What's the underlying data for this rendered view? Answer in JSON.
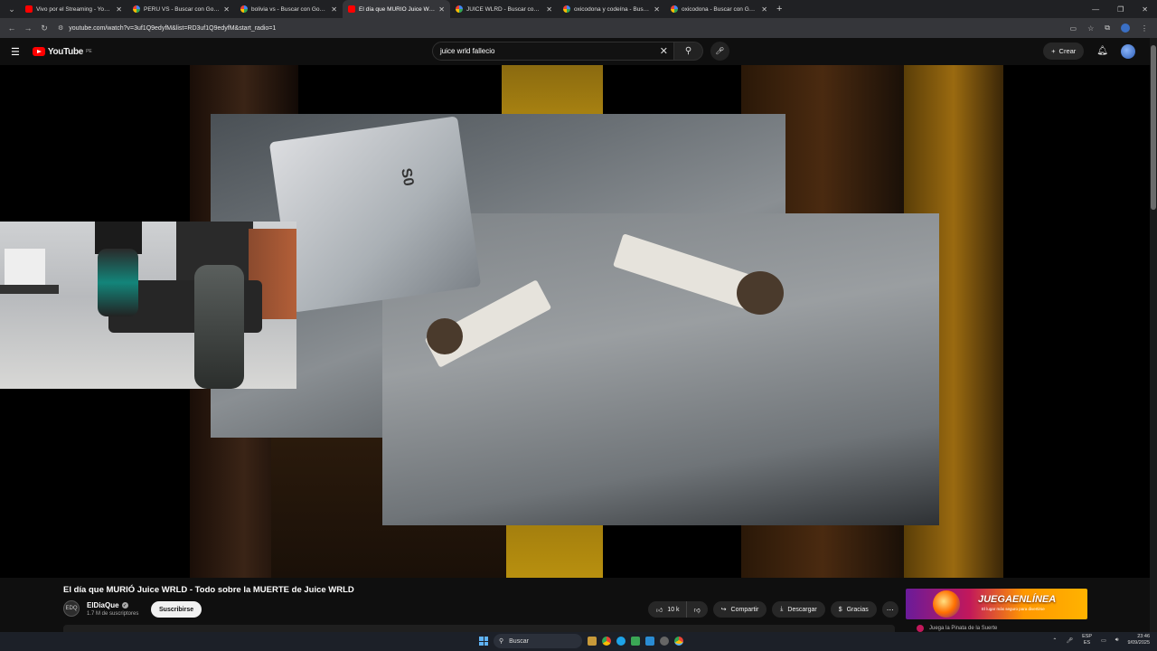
{
  "browser": {
    "tabs": [
      {
        "title": "Vivo por el Streaming - YouTube",
        "icon": "youtube-icon",
        "active": false
      },
      {
        "title": "PERU VS - Buscar con Google",
        "icon": "google-icon",
        "active": false
      },
      {
        "title": "bolivia vs - Buscar con Google",
        "icon": "google-icon",
        "active": false
      },
      {
        "title": "El día que MURIÓ Juice WRLD",
        "icon": "youtube-icon",
        "active": true
      },
      {
        "title": "JUICE WLRD - Buscar con Google",
        "icon": "google-icon",
        "active": false
      },
      {
        "title": "oxicodona y codeína - Buscar con Google",
        "icon": "google-icon",
        "active": false
      },
      {
        "title": "oxicodona - Buscar con Google",
        "icon": "google-icon",
        "active": false
      }
    ],
    "url": "youtube.com/watch?v=3uf1Q9edyfM&list=RD3uf1Q9edyfM&start_radio=1"
  },
  "youtube": {
    "logo_text": "YouTube",
    "country_code": "PE",
    "search_query": "juice wrld fallecio",
    "create_label": "Crear"
  },
  "video": {
    "title": "El día que MURIÓ Juice WRLD - Todo sobre la MUERTE de Juice WRLD",
    "channel_name": "ElDiaQue",
    "channel_avatar_text": "EDQ",
    "subscribers": "1.7 M de suscriptores",
    "subscribe_label": "Suscribirse",
    "likes": "10 k",
    "share_label": "Compartir",
    "download_label": "Descargar",
    "thanks_label": "Gracias",
    "overlay_text": "S0"
  },
  "ad": {
    "title": "JUEGAENLÍNEA",
    "subtitle": "El lugar más seguro para divertirse",
    "row_text": "Juega la Pinata de la Suerte"
  },
  "taskbar": {
    "search_label": "Buscar",
    "lang_top": "ESP",
    "lang_bottom": "ES",
    "time": "23:46",
    "date": "9/09/2025"
  },
  "colors": {
    "youtube_red": "#ff0000",
    "background": "#0f0f0f",
    "ad_accent": "#ffb300"
  }
}
